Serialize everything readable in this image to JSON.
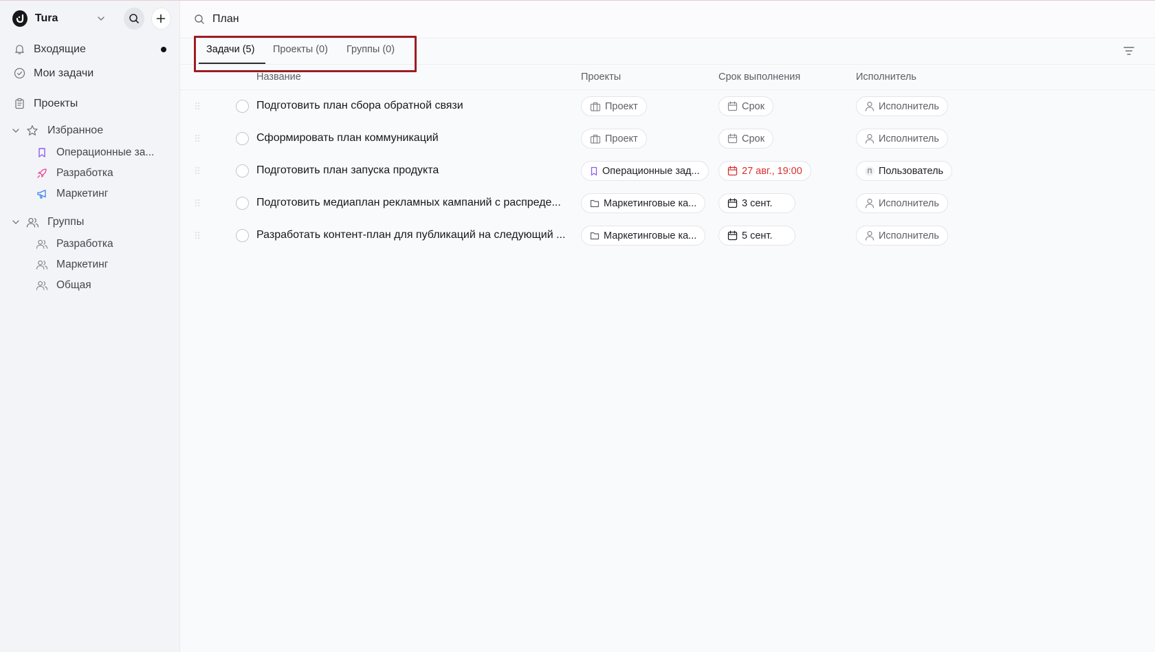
{
  "workspace": {
    "name": "Tura"
  },
  "sidebar": {
    "nav": [
      {
        "label": "Входящие",
        "unread": true
      },
      {
        "label": "Мои задачи"
      },
      {
        "label": "Проекты"
      }
    ],
    "favorites": {
      "label": "Избранное",
      "items": [
        {
          "label": "Операционные за...",
          "icon": "bookmark-icon",
          "color": "#8b5cf6"
        },
        {
          "label": "Разработка",
          "icon": "rocket-icon",
          "color": "#ec4899"
        },
        {
          "label": "Маркетинг",
          "icon": "megaphone-icon",
          "color": "#3b82f6"
        }
      ]
    },
    "groups": {
      "label": "Группы",
      "items": [
        {
          "label": "Разработка"
        },
        {
          "label": "Маркетинг"
        },
        {
          "label": "Общая"
        }
      ]
    }
  },
  "search": {
    "query": "План"
  },
  "tabs": [
    {
      "label": "Задачи (5)",
      "active": true
    },
    {
      "label": "Проекты (0)"
    },
    {
      "label": "Группы (0)"
    }
  ],
  "table": {
    "columns": {
      "name": "Название",
      "project": "Проекты",
      "due": "Срок выполнения",
      "assignee": "Исполнитель"
    },
    "rows": [
      {
        "title": "Подготовить план сбора обратной связи",
        "project": "Проект",
        "due": "Срок",
        "assignee": "Исполнитель"
      },
      {
        "title": "Сформировать план коммуникаций",
        "project": "Проект",
        "due": "Срок",
        "assignee": "Исполнитель"
      },
      {
        "title": "Подготовить план запуска продукта",
        "project": "Операционные зад...",
        "due": "27 авг., 19:00",
        "assignee": "Пользователь",
        "assignee_initial": "П"
      },
      {
        "title": "Подготовить медиаплан рекламных кампаний с распреде...",
        "project": "Маркетинговые ка...",
        "due": "3 сент.",
        "assignee": "Исполнитель"
      },
      {
        "title": "Разработать контент-план для публикаций на следующий ...",
        "project": "Маркетинговые ка...",
        "due": "5 сент.",
        "assignee": "Исполнитель"
      }
    ]
  },
  "colors": {
    "overdue": "#d92d2d",
    "highlight_box": "#9d1c24"
  }
}
